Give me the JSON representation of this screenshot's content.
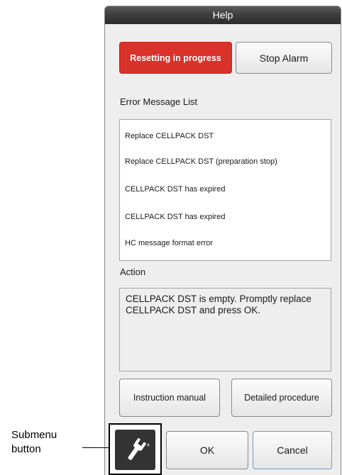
{
  "dialog": {
    "title": "Help",
    "resetting_label": "Resetting in progress",
    "stop_alarm_label": "Stop Alarm",
    "error_list_label": "Error Message List",
    "error_messages": [
      "Replace CELLPACK DST",
      "Replace CELLPACK DST (preparation stop)",
      "CELLPACK DST has expired",
      "CELLPACK DST has expired",
      "HC message format error"
    ],
    "action_label": "Action",
    "action_text": "CELLPACK DST is empty. Promptly replace CELLPACK DST and press OK.",
    "instruction_manual_label": "Instruction manual",
    "detailed_procedure_label": "Detailed procedure",
    "ok_label": "OK",
    "cancel_label": "Cancel",
    "submenu_icon": "wrench-icon"
  },
  "callout": {
    "text_line1": "Submenu",
    "text_line2": "button"
  },
  "colors": {
    "titlebar": "#3c3c3c",
    "resetting_button": "#d8322a",
    "submenu_button": "#333333",
    "dialog_background": "#eeeeee"
  }
}
